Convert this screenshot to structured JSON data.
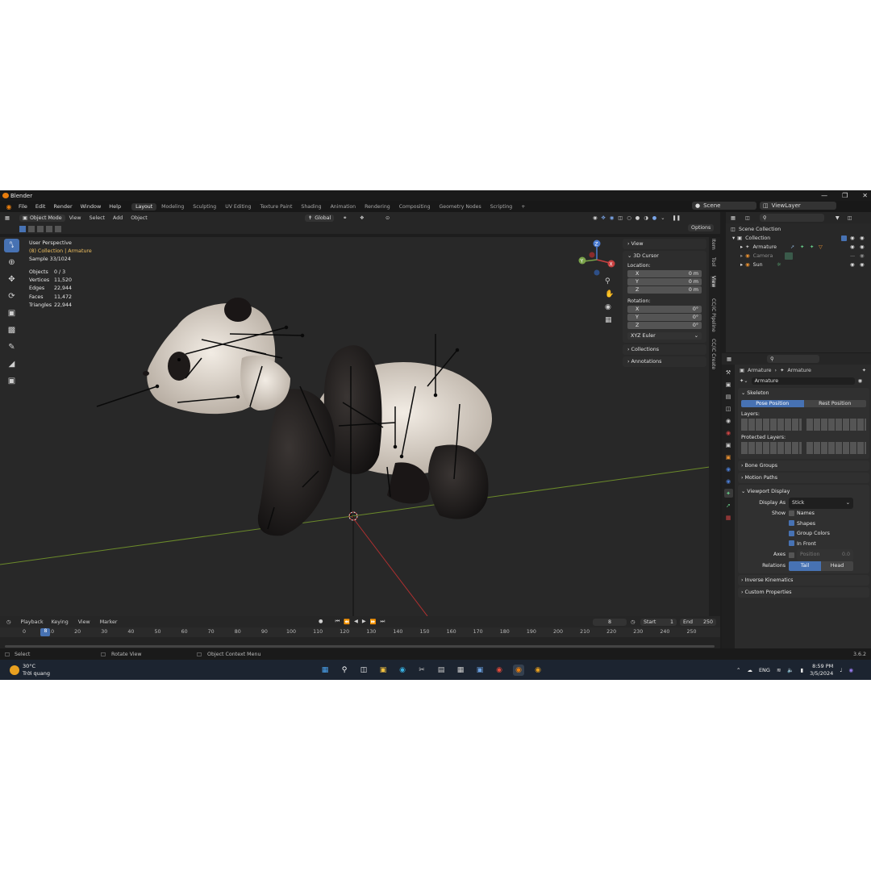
{
  "window": {
    "title": "Blender",
    "version": "3.6.2"
  },
  "menu": [
    "File",
    "Edit",
    "Render",
    "Window",
    "Help"
  ],
  "workspaces": [
    "Layout",
    "Modeling",
    "Sculpting",
    "UV Editing",
    "Texture Paint",
    "Shading",
    "Animation",
    "Rendering",
    "Compositing",
    "Geometry Nodes",
    "Scripting"
  ],
  "scene": {
    "name": "Scene",
    "view_layer": "ViewLayer"
  },
  "viewport_header": {
    "mode": "Object Mode",
    "menus": [
      "View",
      "Select",
      "Add",
      "Object"
    ],
    "transform": "Global",
    "options_label": "Options"
  },
  "overlay": {
    "perspective": "User Perspective",
    "collection": "(8) Collection | Armature",
    "sample": "Sample 33/1024",
    "stats": [
      {
        "label": "Objects",
        "value": "0 / 3"
      },
      {
        "label": "Vertices",
        "value": "11,520"
      },
      {
        "label": "Edges",
        "value": "22,944"
      },
      {
        "label": "Faces",
        "value": "11,472"
      },
      {
        "label": "Triangles",
        "value": "22,944"
      }
    ]
  },
  "npanel": {
    "view_label": "View",
    "cursor_label": "3D Cursor",
    "location_label": "Location:",
    "location": [
      {
        "axis": "X",
        "value": "0 m"
      },
      {
        "axis": "Y",
        "value": "0 m"
      },
      {
        "axis": "Z",
        "value": "0 m"
      }
    ],
    "rotation_label": "Rotation:",
    "rotation": [
      {
        "axis": "X",
        "value": "0°"
      },
      {
        "axis": "Y",
        "value": "0°"
      },
      {
        "axis": "Z",
        "value": "0°"
      }
    ],
    "rotation_mode": "XYZ Euler",
    "collections_label": "Collections",
    "annotations_label": "Annotations",
    "tabs": [
      "Item",
      "Tool",
      "View",
      "CC/iC Pipeline",
      "CC/iC Create"
    ]
  },
  "outliner": {
    "root": "Scene Collection",
    "collection": "Collection",
    "items": [
      "Armature",
      "Camera",
      "Sun"
    ]
  },
  "properties": {
    "breadcrumb_a": "Armature",
    "breadcrumb_b": "Armature",
    "object_name": "Armature",
    "skeleton_label": "Skeleton",
    "pose_position": "Pose Position",
    "rest_position": "Rest Position",
    "layers_label": "Layers:",
    "protected_layers_label": "Protected Layers:",
    "bone_groups": "Bone Groups",
    "motion_paths": "Motion Paths",
    "viewport_display": "Viewport Display",
    "display_as_label": "Display As",
    "display_as_value": "Stick",
    "show_label": "Show",
    "show_options": [
      {
        "label": "Names",
        "checked": false
      },
      {
        "label": "Shapes",
        "checked": true
      },
      {
        "label": "Group Colors",
        "checked": true
      },
      {
        "label": "In Front",
        "checked": true
      }
    ],
    "axes_label": "Axes",
    "position_label": "Position",
    "position_value": "0.0",
    "relations_label": "Relations",
    "tail_label": "Tail",
    "head_label": "Head",
    "inverse_kinematics": "Inverse Kinematics",
    "custom_properties": "Custom Properties"
  },
  "timeline": {
    "menus": [
      "Playback",
      "Keying",
      "View",
      "Marker"
    ],
    "current_frame": "8",
    "start_label": "Start",
    "start": "1",
    "end_label": "End",
    "end": "250",
    "ticks": [
      "0",
      "10",
      "20",
      "30",
      "40",
      "50",
      "60",
      "70",
      "80",
      "90",
      "100",
      "110",
      "120",
      "130",
      "140",
      "150",
      "160",
      "170",
      "180",
      "190",
      "200",
      "210",
      "220",
      "230",
      "240",
      "250"
    ],
    "marker": "8"
  },
  "statusbar": {
    "select": "Select",
    "rotate": "Rotate View",
    "context": "Object Context Menu"
  },
  "taskbar": {
    "weather_temp": "30°C",
    "weather_desc": "Trời quang",
    "lang": "ENG",
    "time": "8:59 PM",
    "date": "3/5/2024"
  },
  "colors": {
    "accent": "#4772b3",
    "bg": "#2a2a2a",
    "panel": "#2b2b2b"
  }
}
